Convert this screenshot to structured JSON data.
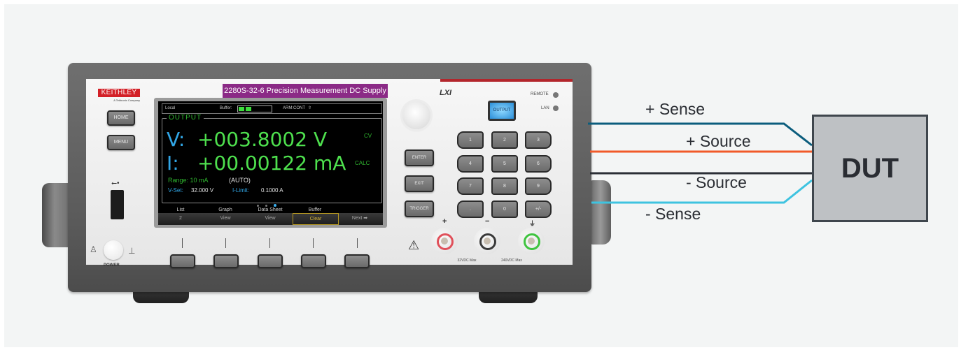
{
  "instrument": {
    "brand": "KEITHLEY",
    "brand_sub": "A Tektronix Company",
    "model_title": "2280S-32-6 Precision Measurement DC Supply",
    "side_buttons": [
      "HOME",
      "MENU"
    ],
    "power_label": "POWER",
    "usb_icon": "usb-icon",
    "lxi_logo": "LXI",
    "indicators": [
      "REMOTE",
      "LAN"
    ],
    "output_button": "OUTPUT",
    "function_buttons": [
      "ENTER",
      "EXIT",
      "TRIGGER"
    ],
    "keypad": [
      "1",
      "2",
      "3",
      "4",
      "5",
      "6",
      "7",
      "8",
      "9",
      ".",
      "0",
      "+/-"
    ],
    "terminals": [
      {
        "label": "+",
        "color": "#e0505a"
      },
      {
        "label": "−",
        "color": "#3a3a3a"
      },
      {
        "label": "⏚",
        "color": "#3fc43f"
      }
    ],
    "ratings": [
      "32VDC Max",
      "240VDC Max"
    ],
    "warning_icon": "warning-triangle-icon"
  },
  "display": {
    "status": {
      "mode": "Local",
      "buffer_label": "Buffer:",
      "buffer_fill_fraction": 0.4,
      "arm": "ARM:CONT"
    },
    "section_title": "OUTPUT",
    "voltage": {
      "label": "V:",
      "value": "+003.8002 V",
      "mode": "CV"
    },
    "current": {
      "label": "I:",
      "value": "+00.00122 mA",
      "mode": "CALC"
    },
    "range": {
      "label": "Range: 10 mA",
      "auto": "(AUTO)"
    },
    "vset": {
      "label": "V-Set:",
      "value": "32.000 V"
    },
    "ilimit": {
      "label": "I-Limit:",
      "value": "0.1000 A"
    },
    "page_indicator": {
      "count": 3,
      "active": 3
    },
    "softkeys": [
      {
        "top": "List",
        "bottom": "2"
      },
      {
        "top": "Graph",
        "bottom": "View"
      },
      {
        "top": "Data Sheet",
        "bottom": "View"
      },
      {
        "top": "Buffer",
        "bottom": "Clear",
        "selected": true
      },
      {
        "top": "",
        "bottom": "Next ➡"
      }
    ]
  },
  "diagram": {
    "wires": [
      {
        "label": "+ Sense",
        "color": "#0b5d7d"
      },
      {
        "label": "+ Source",
        "color": "#f15a29"
      },
      {
        "label": "- Source",
        "color": "#2b2f36"
      },
      {
        "label": "- Sense",
        "color": "#3ec3e0"
      }
    ],
    "dut_label": "DUT"
  }
}
